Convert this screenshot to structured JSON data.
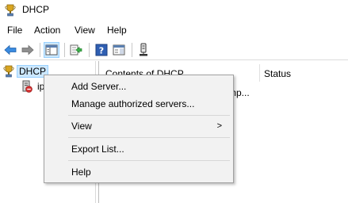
{
  "window": {
    "title": "DHCP",
    "icon": "dhcp-trophy-icon"
  },
  "menubar": {
    "items": [
      "File",
      "Action",
      "View",
      "Help"
    ]
  },
  "toolbar": {
    "buttons": [
      "back-arrow-icon",
      "forward-arrow-icon",
      "show-hide-console-tree-icon",
      "export-list-icon",
      "help-icon",
      "show-action-pane-icon",
      "server-icon"
    ]
  },
  "tree": {
    "root_label": "DHCP",
    "child_label": "ip"
  },
  "content": {
    "columns": [
      "Contents of DHCP",
      "Status"
    ],
    "row_fragment": "mp..."
  },
  "context_menu": {
    "items": [
      {
        "label": "Add Server..."
      },
      {
        "label": "Manage authorized servers..."
      },
      {
        "label": "View",
        "submenu_arrow": ">"
      },
      {
        "label": "Export List..."
      },
      {
        "label": "Help"
      }
    ]
  },
  "colors": {
    "selection_fill": "#cce8ff",
    "selection_border": "#99d1ff",
    "menu_bg": "#f2f2f2"
  }
}
